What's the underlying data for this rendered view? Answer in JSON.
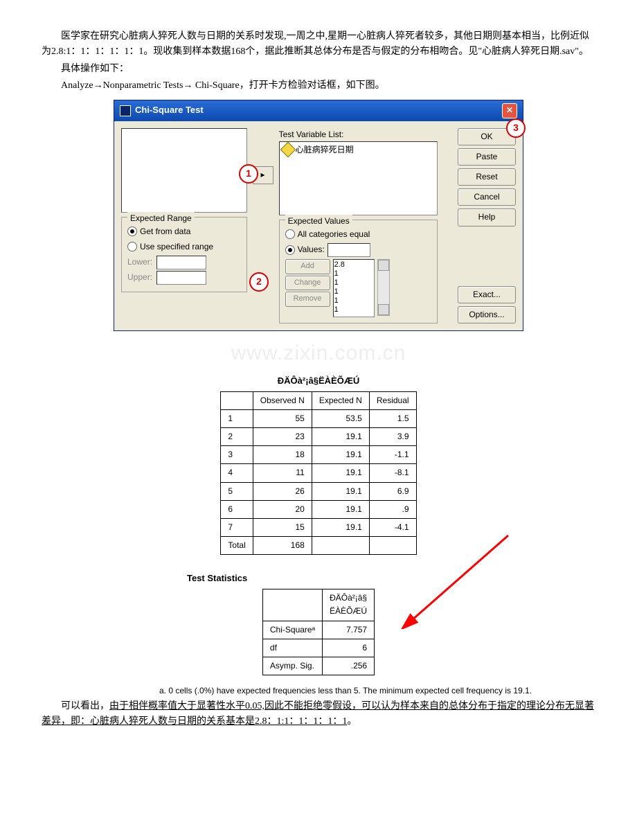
{
  "para1": "医学家在研究心脏病人猝死人数与日期的关系时发现,一周之中,星期一心脏病人猝死者较多，其他日期则基本相当，比例近似为2.8:1：1：1：1：1：1。现收集到样本数据168个，据此推断其总体分布是否与假定的分布相吻合。见\"心脏病人猝死日期.sav\"。",
  "para2": "具体操作如下：",
  "para3": "Analyze→Nonparametric Tests→ Chi-Square，打开卡方检验对话框，如下图。",
  "dialog": {
    "title": "Chi-Square Test",
    "test_var_label": "Test Variable List:",
    "var_item": "心脏病猝死日期",
    "buttons": {
      "ok": "OK",
      "paste": "Paste",
      "reset": "Reset",
      "cancel": "Cancel",
      "help": "Help",
      "exact": "Exact...",
      "options": "Options..."
    },
    "expected_range": {
      "legend": "Expected Range",
      "get": "Get from data",
      "use": "Use specified range",
      "lower": "Lower:",
      "upper": "Upper:"
    },
    "expected_values": {
      "legend": "Expected Values",
      "all": "All categories equal",
      "values": "Values:",
      "add": "Add",
      "change": "Change",
      "remove": "Remove",
      "list": [
        "2.8",
        "1",
        "1",
        "1",
        "1",
        "1"
      ]
    }
  },
  "markers": {
    "m1": "1",
    "m2": "2",
    "m3": "3"
  },
  "watermark": "www.zixin.com.cn",
  "chart_data": [
    {
      "type": "table",
      "title": "ÐÄÔà²¡â§ËÀÈÕÆÚ",
      "columns": [
        "",
        "Observed N",
        "Expected N",
        "Residual"
      ],
      "rows": [
        [
          "1",
          "55",
          "53.5",
          "1.5"
        ],
        [
          "2",
          "23",
          "19.1",
          "3.9"
        ],
        [
          "3",
          "18",
          "19.1",
          "-1.1"
        ],
        [
          "4",
          "11",
          "19.1",
          "-8.1"
        ],
        [
          "5",
          "26",
          "19.1",
          "6.9"
        ],
        [
          "6",
          "20",
          "19.1",
          ".9"
        ],
        [
          "7",
          "15",
          "19.1",
          "-4.1"
        ],
        [
          "Total",
          "168",
          "",
          ""
        ]
      ]
    },
    {
      "type": "table",
      "title": "Test Statistics",
      "col_header": "ÐÄÔà²¡â§\nËÀÈÕÆÚ",
      "rows": [
        [
          "Chi-Squareᵃ",
          "7.757"
        ],
        [
          "df",
          "6"
        ],
        [
          "Asymp. Sig.",
          ".256"
        ]
      ],
      "footnote_label": "a.",
      "footnote": "0 cells (.0%) have expected frequencies less than 5. The minimum expected cell frequency is 19.1."
    }
  ],
  "conclusion_prefix": "可以看出，",
  "conclusion_underlined": "由于相伴概率值大于显著性水平0.05,因此不能拒绝零假设，可以认为样本来自的总体分布于指定的理论分布无显著差异，即：心脏病人猝死人数与日期的关系基本是2.8：1:1：1：1：1：1",
  "conclusion_suffix": "。"
}
